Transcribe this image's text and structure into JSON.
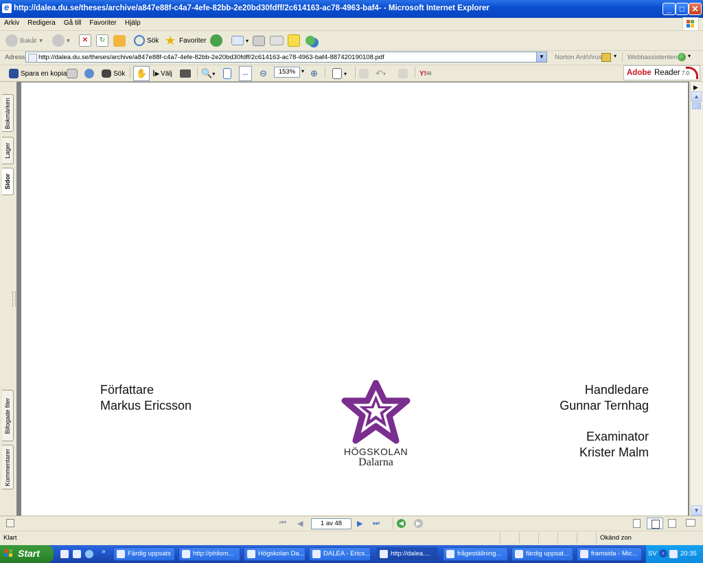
{
  "window": {
    "title": "http://dalea.du.se/theses/archive/a847e88f-c4a7-4efe-82bb-2e20bd30fdff/2c614163-ac78-4963-baf4- - Microsoft Internet Explorer"
  },
  "menu": [
    "Arkiv",
    "Redigera",
    "Gå till",
    "Favoriter",
    "Hjälp"
  ],
  "std_toolbar": {
    "back": "Bakåt",
    "search": "Sök",
    "favorites": "Favoriter"
  },
  "address": {
    "label": "Adress",
    "url": "http://dalea.du.se/theses/archive/a847e88f-c4a7-4efe-82bb-2e20bd30fdff/2c614163-ac78-4963-baf4-887420190108.pdf",
    "norton": "Norton AntiVirus",
    "webassist": "Webbassistenten"
  },
  "adobe_toolbar": {
    "save_copy": "Spara en kopia",
    "search": "Sök",
    "select": "Välj",
    "zoom": "153%",
    "brand": "Adobe",
    "product": "Reader",
    "version": "7.0"
  },
  "side_tabs": {
    "bookmarks": "Bokmärken",
    "layers": "Lager",
    "pages": "Sidor",
    "attachments": "Bifogade filer",
    "comments": "Kommentarer"
  },
  "document": {
    "author_label": "Författare",
    "author_name": "Markus Ericsson",
    "supervisor_label": "Handledare",
    "supervisor_name": "Gunnar Ternhag",
    "examiner_label": "Examinator",
    "examiner_name": "Krister Malm",
    "logo_line1": "HÖGSKOLAN",
    "logo_line2": "Dalarna",
    "logo_color": "#7a2e8e"
  },
  "nav": {
    "page_indicator": "1 av 48"
  },
  "status": {
    "left": "Klart",
    "zone": "Okänd zon"
  },
  "taskbar": {
    "start": "Start",
    "tasks": [
      "Färdig uppsats",
      "http://philom...",
      "Högskolan Da...",
      "DALEA - Erics...",
      "http://dalea....",
      "frågeställning...",
      "färdig uppsat...",
      "framsida - Mic..."
    ],
    "lang": "SV",
    "clock": "20:35"
  }
}
